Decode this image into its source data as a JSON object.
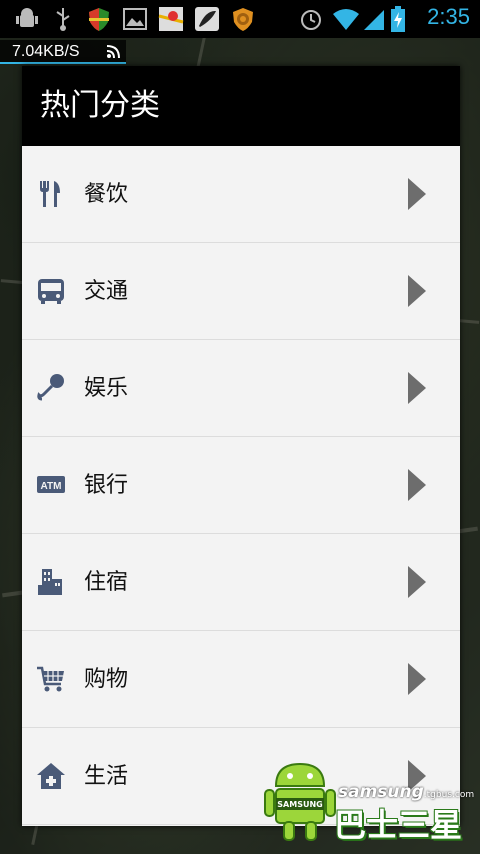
{
  "status_bar": {
    "time": "2:35",
    "notification_icons": [
      "android-debug-icon",
      "usb-icon",
      "shield-icon",
      "image-icon",
      "maps-icon",
      "feather-icon",
      "settings-icon"
    ],
    "status_icons": [
      "alarm-icon",
      "wifi-icon",
      "signal-icon",
      "battery-charging-icon"
    ]
  },
  "network_speed": {
    "value": "7.04KB/S"
  },
  "dialog": {
    "title": "热门分类",
    "items": [
      {
        "label": "餐饮",
        "icon": "fork-knife-icon"
      },
      {
        "label": "交通",
        "icon": "bus-icon"
      },
      {
        "label": "娱乐",
        "icon": "microphone-icon"
      },
      {
        "label": "银行",
        "icon": "atm-icon"
      },
      {
        "label": "住宿",
        "icon": "building-icon"
      },
      {
        "label": "购物",
        "icon": "shopping-cart-icon"
      },
      {
        "label": "生活",
        "icon": "house-plus-icon"
      }
    ]
  },
  "watermark": {
    "brand": "samsung",
    "domain": ".tgbus.com",
    "title": "巴士三星",
    "badge": "SAMSUNG"
  },
  "colors": {
    "status_time": "#33b5e5",
    "icon_color": "#4a5a78",
    "arrow_color": "#6d6d6d",
    "header_bg": "#000000",
    "list_bg": "#f3f3f3"
  }
}
